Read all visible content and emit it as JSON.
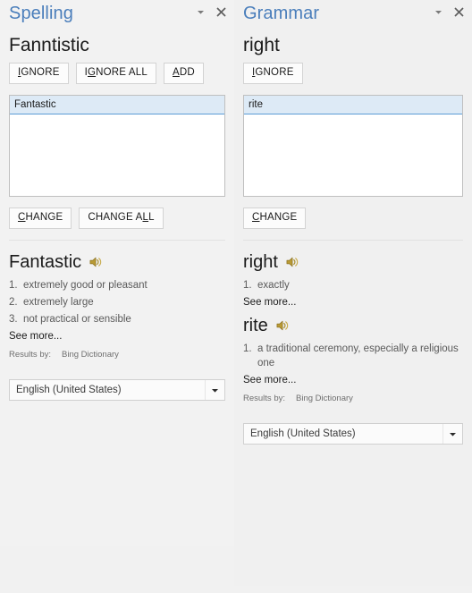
{
  "spelling": {
    "title": "Spelling",
    "collapse_icon": "chevron-down-icon",
    "close_icon": "close-icon",
    "error_word": "Fanntistic",
    "buttons": {
      "ignore": "IGNORE",
      "ignore_accel": "I",
      "ignore_all": "IGNORE ALL",
      "ignore_all_accel": "G",
      "add": "ADD",
      "add_accel": "A",
      "change": "CHANGE",
      "change_accel": "C",
      "change_all": "CHANGE ALL",
      "change_all_accel": "L"
    },
    "suggestions": [
      "Fantastic"
    ],
    "selected_suggestion": "Fantastic",
    "definition": {
      "word": "Fantastic",
      "speaker_icon": "speaker-icon",
      "entries": [
        {
          "num": "1.",
          "text": "extremely good or pleasant"
        },
        {
          "num": "2.",
          "text": "extremely large"
        },
        {
          "num": "3.",
          "text": "not practical or sensible"
        }
      ],
      "see_more": "See more..."
    },
    "results_by_label": "Results by:",
    "results_by_source": "Bing Dictionary",
    "language": "English (United States)"
  },
  "grammar": {
    "title": "Grammar",
    "collapse_icon": "chevron-down-icon",
    "close_icon": "close-icon",
    "error_word": "right",
    "buttons": {
      "ignore": "IGNORE",
      "ignore_accel": "I",
      "change": "CHANGE",
      "change_accel": "C"
    },
    "suggestions": [
      "rite"
    ],
    "selected_suggestion": "rite",
    "definitions": [
      {
        "word": "right",
        "speaker_icon": "speaker-icon",
        "entries": [
          {
            "num": "1.",
            "text": "exactly"
          }
        ],
        "see_more": "See more..."
      },
      {
        "word": "rite",
        "speaker_icon": "speaker-icon",
        "entries": [
          {
            "num": "1.",
            "text": "a traditional ceremony, especially a religious one"
          }
        ],
        "see_more": "See more..."
      }
    ],
    "results_by_label": "Results by:",
    "results_by_source": "Bing Dictionary",
    "language": "English (United States)"
  },
  "colors": {
    "title_blue": "#4a7ebb",
    "selection_fill": "#ddeaf6",
    "selection_border": "#5b9bd5",
    "panel_bg": "#f2f2f2",
    "speaker_gold": "#c9a227"
  }
}
